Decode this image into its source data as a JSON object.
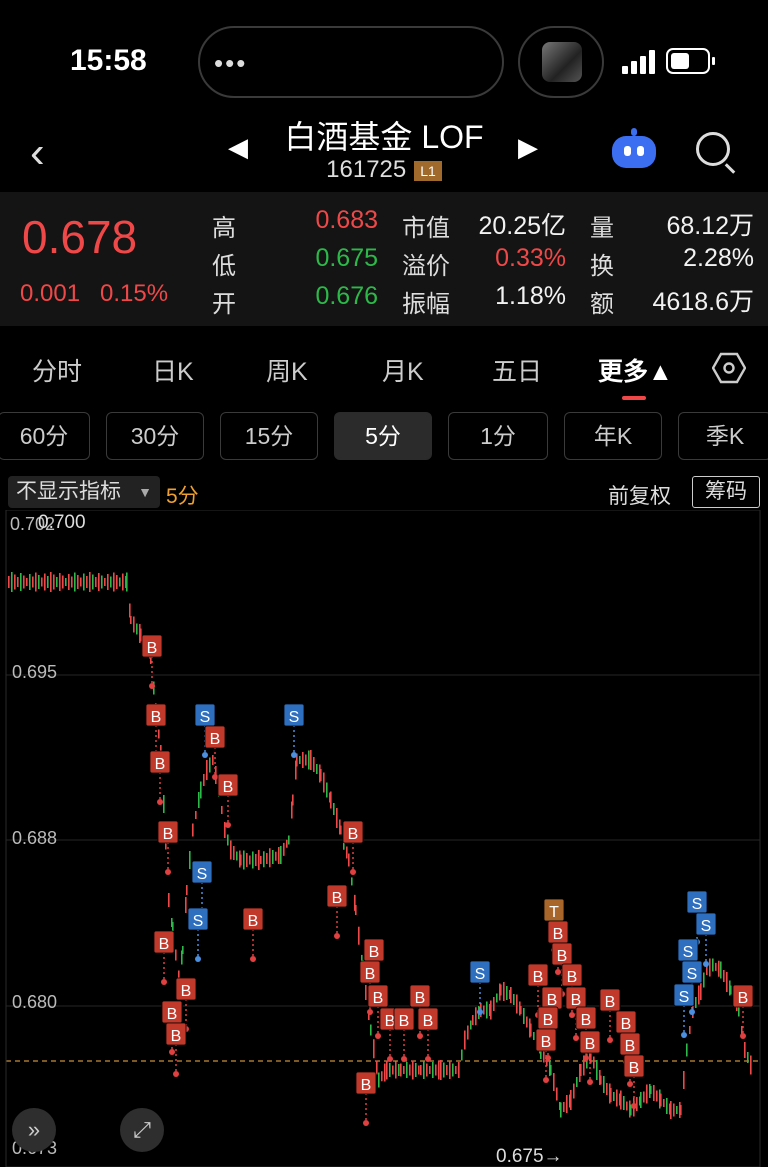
{
  "status_bar": {
    "time": "15:58"
  },
  "header": {
    "title": "白酒基金 LOF",
    "code": "161725",
    "level_badge": "L1"
  },
  "quote": {
    "price": "0.678",
    "change": "0.001",
    "change_pct": "0.15%",
    "high_label": "高",
    "high": "0.683",
    "low_label": "低",
    "low": "0.675",
    "open_label": "开",
    "open": "0.676",
    "mktcap_label": "市值",
    "mktcap": "20.25亿",
    "premium_label": "溢价",
    "premium": "0.33%",
    "amplitude_label": "振幅",
    "amplitude": "1.18%",
    "volume_label": "量",
    "volume": "68.12万",
    "turnover_label": "换",
    "turnover": "2.28%",
    "amount_label": "额",
    "amount": "4618.6万"
  },
  "colors": {
    "up": "#f04848",
    "down": "#2db84a",
    "accent": "#f0a030",
    "buy_badge": "#c0392b",
    "sell_badge": "#2f6fc0"
  },
  "tabs": [
    "分时",
    "日K",
    "周K",
    "月K",
    "五日",
    "更多▲"
  ],
  "periods": [
    "60分",
    "30分",
    "15分",
    "5分",
    "1分",
    "年K",
    "季K"
  ],
  "indicator": {
    "selector": "不显示指标",
    "period": "5分",
    "adjust": "前复权",
    "chips": "筹码"
  },
  "chart_data": {
    "type": "candlestick",
    "ylim": [
      0.673,
      0.702
    ],
    "y_ticks": [
      "0.702",
      "0.695",
      "0.688",
      "0.680",
      "0.673"
    ],
    "top_label": "0.700",
    "bottom_marker": "0.675→",
    "last_price_line": 0.677
  }
}
